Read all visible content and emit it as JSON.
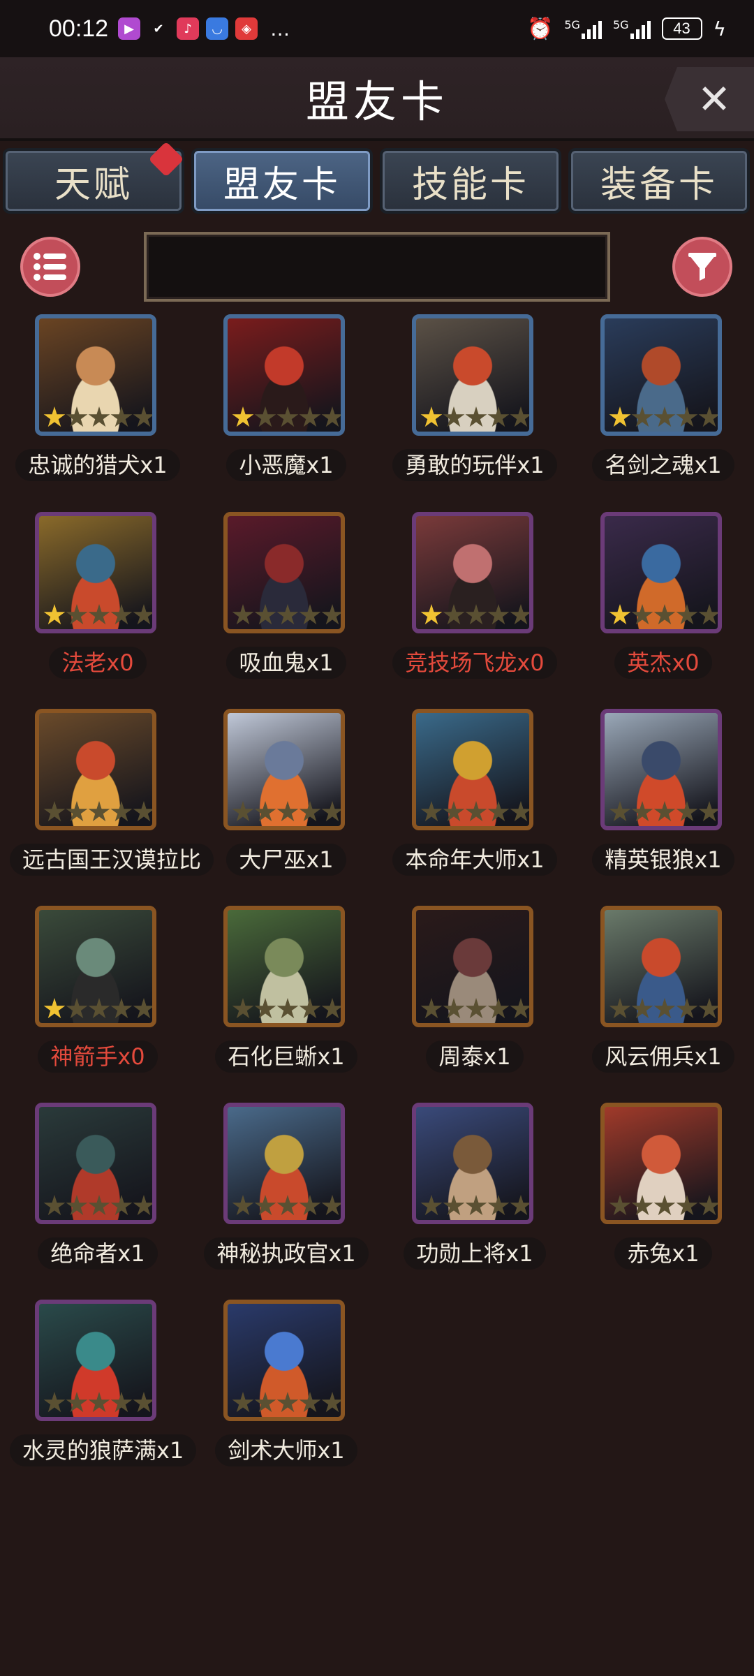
{
  "status_bar": {
    "time": "00:12",
    "network_1": "5G",
    "network_2": "5G",
    "battery": "43"
  },
  "header": {
    "title": "盟友卡",
    "close_icon": "close-icon"
  },
  "tabs": [
    {
      "label": "天赋",
      "active": false,
      "badge": true
    },
    {
      "label": "盟友卡",
      "active": true,
      "badge": false
    },
    {
      "label": "技能卡",
      "active": false,
      "badge": false
    },
    {
      "label": "装备卡",
      "active": false,
      "badge": false
    }
  ],
  "search": {
    "value": ""
  },
  "colors": {
    "owned_text": "#f2ece0",
    "missing_text": "#e44a3c",
    "star_on": "#f0c232",
    "star_off": "#5a5032",
    "accent_button": "#c24e5a"
  },
  "cards": [
    {
      "name": "忠诚的猎犬x1",
      "rarity": "blue",
      "stars": 1,
      "owned": true,
      "art": [
        "#6a4423",
        "#c88a55",
        "#e9d6b0"
      ]
    },
    {
      "name": "小恶魔x1",
      "rarity": "blue",
      "stars": 1,
      "owned": true,
      "art": [
        "#7a1c1c",
        "#c23a2a",
        "#2a1a1a"
      ]
    },
    {
      "name": "勇敢的玩伴x1",
      "rarity": "blue",
      "stars": 1,
      "owned": true,
      "art": [
        "#5b5146",
        "#c94a2c",
        "#d8d0c0"
      ]
    },
    {
      "name": "名剑之魂x1",
      "rarity": "blue",
      "stars": 1,
      "owned": true,
      "art": [
        "#2a3c5a",
        "#b04a2a",
        "#4a6a8a"
      ]
    },
    {
      "name": "法老x0",
      "rarity": "purple",
      "stars": 1,
      "owned": false,
      "art": [
        "#8a6a2a",
        "#3a6a8a",
        "#c94a2c"
      ]
    },
    {
      "name": "吸血鬼x1",
      "rarity": "orange",
      "stars": 0,
      "owned": true,
      "art": [
        "#5a1a2a",
        "#8a2a2a",
        "#2a2a3a"
      ]
    },
    {
      "name": "竞技场飞龙x0",
      "rarity": "purple",
      "stars": 1,
      "owned": false,
      "art": [
        "#7a3a3a",
        "#c07070",
        "#2a2020"
      ]
    },
    {
      "name": "英杰x0",
      "rarity": "purple",
      "stars": 1,
      "owned": false,
      "art": [
        "#3a2a4a",
        "#3a6aa0",
        "#d06a2a"
      ]
    },
    {
      "name": "远古国王汉谟拉比",
      "rarity": "orange",
      "stars": 0,
      "owned": true,
      "art": [
        "#6a4a2a",
        "#c94a2c",
        "#e0a040"
      ]
    },
    {
      "name": "大尸巫x1",
      "rarity": "orange",
      "stars": 0,
      "owned": true,
      "art": [
        "#c0c8d8",
        "#6a7a9a",
        "#e07030"
      ]
    },
    {
      "name": "本命年大师x1",
      "rarity": "orange",
      "stars": 0,
      "owned": true,
      "art": [
        "#3a6a8a",
        "#d0a030",
        "#c94a2c"
      ]
    },
    {
      "name": "精英银狼x1",
      "rarity": "purple",
      "stars": 0,
      "owned": true,
      "art": [
        "#9aa8b8",
        "#3a4a6a",
        "#d04a2a"
      ]
    },
    {
      "name": "神箭手x0",
      "rarity": "orange",
      "stars": 1,
      "owned": false,
      "art": [
        "#3a4a3a",
        "#6a8a7a",
        "#2a2a2a"
      ]
    },
    {
      "name": "石化巨蜥x1",
      "rarity": "orange",
      "stars": 0,
      "owned": true,
      "art": [
        "#4a6a3a",
        "#7a8a5a",
        "#c0c0a0"
      ]
    },
    {
      "name": "周泰x1",
      "rarity": "orange",
      "stars": 0,
      "owned": true,
      "art": [
        "#2a1a1a",
        "#6a3a3a",
        "#9a8a7a"
      ]
    },
    {
      "name": "风云佣兵x1",
      "rarity": "orange",
      "stars": 0,
      "owned": true,
      "art": [
        "#6a7a6a",
        "#c94a2c",
        "#3a5a8a"
      ]
    },
    {
      "name": "绝命者x1",
      "rarity": "purple",
      "stars": 0,
      "owned": true,
      "art": [
        "#2a3a3a",
        "#3a5a5a",
        "#b03a2a"
      ]
    },
    {
      "name": "神秘执政官x1",
      "rarity": "purple",
      "stars": 0,
      "owned": true,
      "art": [
        "#4a6a8a",
        "#c0a040",
        "#c94a2c"
      ]
    },
    {
      "name": "功勋上将x1",
      "rarity": "purple",
      "stars": 0,
      "owned": true,
      "art": [
        "#3a4a7a",
        "#7a5a3a",
        "#c0a080"
      ]
    },
    {
      "name": "赤兔x1",
      "rarity": "orange",
      "stars": 0,
      "owned": true,
      "art": [
        "#a03a2a",
        "#d05a3a",
        "#e0d0c0"
      ]
    },
    {
      "name": "水灵的狼萨满x1",
      "rarity": "purple",
      "stars": 0,
      "owned": true,
      "art": [
        "#2a4a4a",
        "#3a8a8a",
        "#d03a2a"
      ]
    },
    {
      "name": "剑术大师x1",
      "rarity": "orange",
      "stars": 0,
      "owned": true,
      "art": [
        "#2a3a6a",
        "#4a7ad0",
        "#d05a2a"
      ]
    }
  ]
}
